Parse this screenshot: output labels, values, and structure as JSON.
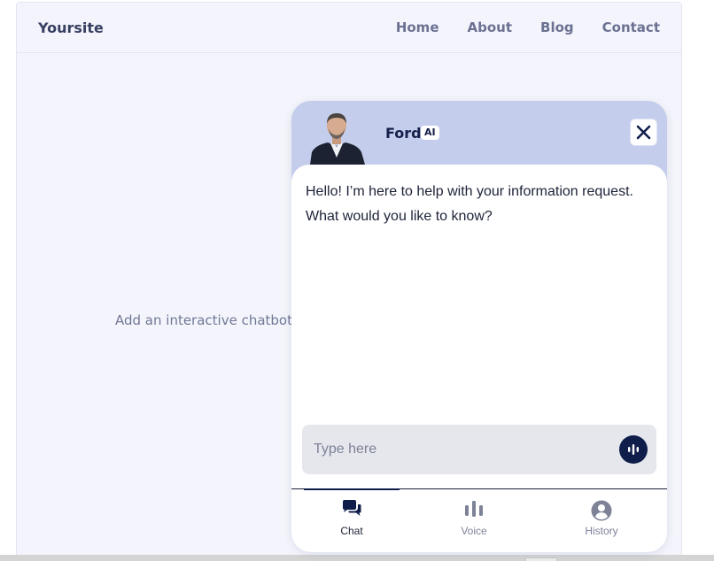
{
  "site": {
    "logo": "Yoursite",
    "nav": [
      "Home",
      "About",
      "Blog",
      "Contact"
    ],
    "hero_text": "Add an interactive chatbot p"
  },
  "chat": {
    "agent_name": "Ford",
    "badge": "AI",
    "message": "Hello! I’m here to help with your information request. What would you like to know?",
    "input_placeholder": "Type here",
    "tabs": [
      {
        "label": "Chat",
        "icon": "chat-bubbles-icon",
        "active": true
      },
      {
        "label": "Voice",
        "icon": "voice-bars-icon",
        "active": false
      },
      {
        "label": "History",
        "icon": "user-circle-icon",
        "active": false
      }
    ],
    "colors": {
      "header_bg": "#c4cdec",
      "accent": "#0f1d4a"
    }
  }
}
